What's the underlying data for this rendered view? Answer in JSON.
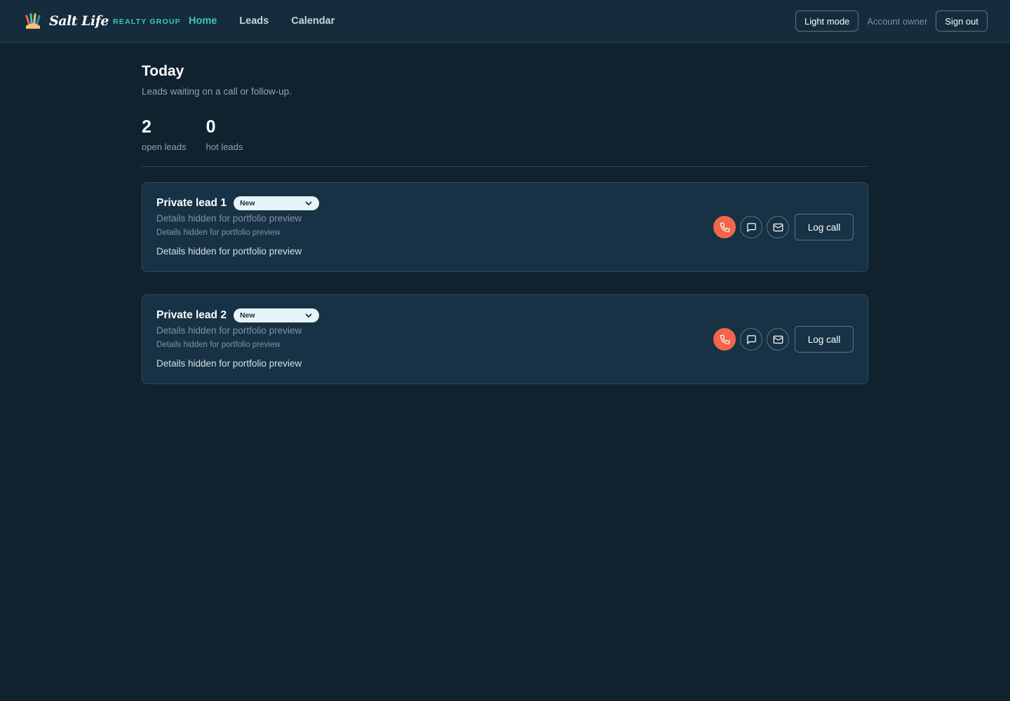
{
  "brand": {
    "script_name": "Salt Life",
    "sub_name": "REALTY GROUP"
  },
  "nav": [
    {
      "label": "Home",
      "active": true
    },
    {
      "label": "Leads",
      "active": false
    },
    {
      "label": "Calendar",
      "active": false
    }
  ],
  "header_right": {
    "theme_toggle": "Light mode",
    "account_label": "Account owner",
    "sign_out": "Sign out"
  },
  "page": {
    "title": "Today",
    "subtitle": "Leads waiting on a call or follow-up."
  },
  "stats": [
    {
      "value": "2",
      "label": "open leads"
    },
    {
      "value": "0",
      "label": "hot leads"
    }
  ],
  "leads": [
    {
      "name": "Private lead 1",
      "status": "New",
      "line1": "Details hidden for portfolio preview",
      "line2": "Details hidden for portfolio preview",
      "line3": "Details hidden for portfolio preview",
      "log_call": "Log call"
    },
    {
      "name": "Private lead 2",
      "status": "New",
      "line1": "Details hidden for portfolio preview",
      "line2": "Details hidden for portfolio preview",
      "line3": "Details hidden for portfolio preview",
      "log_call": "Log call"
    }
  ],
  "icons": {
    "call": "phone-icon",
    "text": "message-icon",
    "email": "mail-icon",
    "status_dropdown": "chevron-down-icon"
  },
  "colors": {
    "background": "#10222e",
    "header": "#142c3b",
    "card": "#163244",
    "accent_teal": "#3fc6c0",
    "call_orange": "#f2664b"
  }
}
